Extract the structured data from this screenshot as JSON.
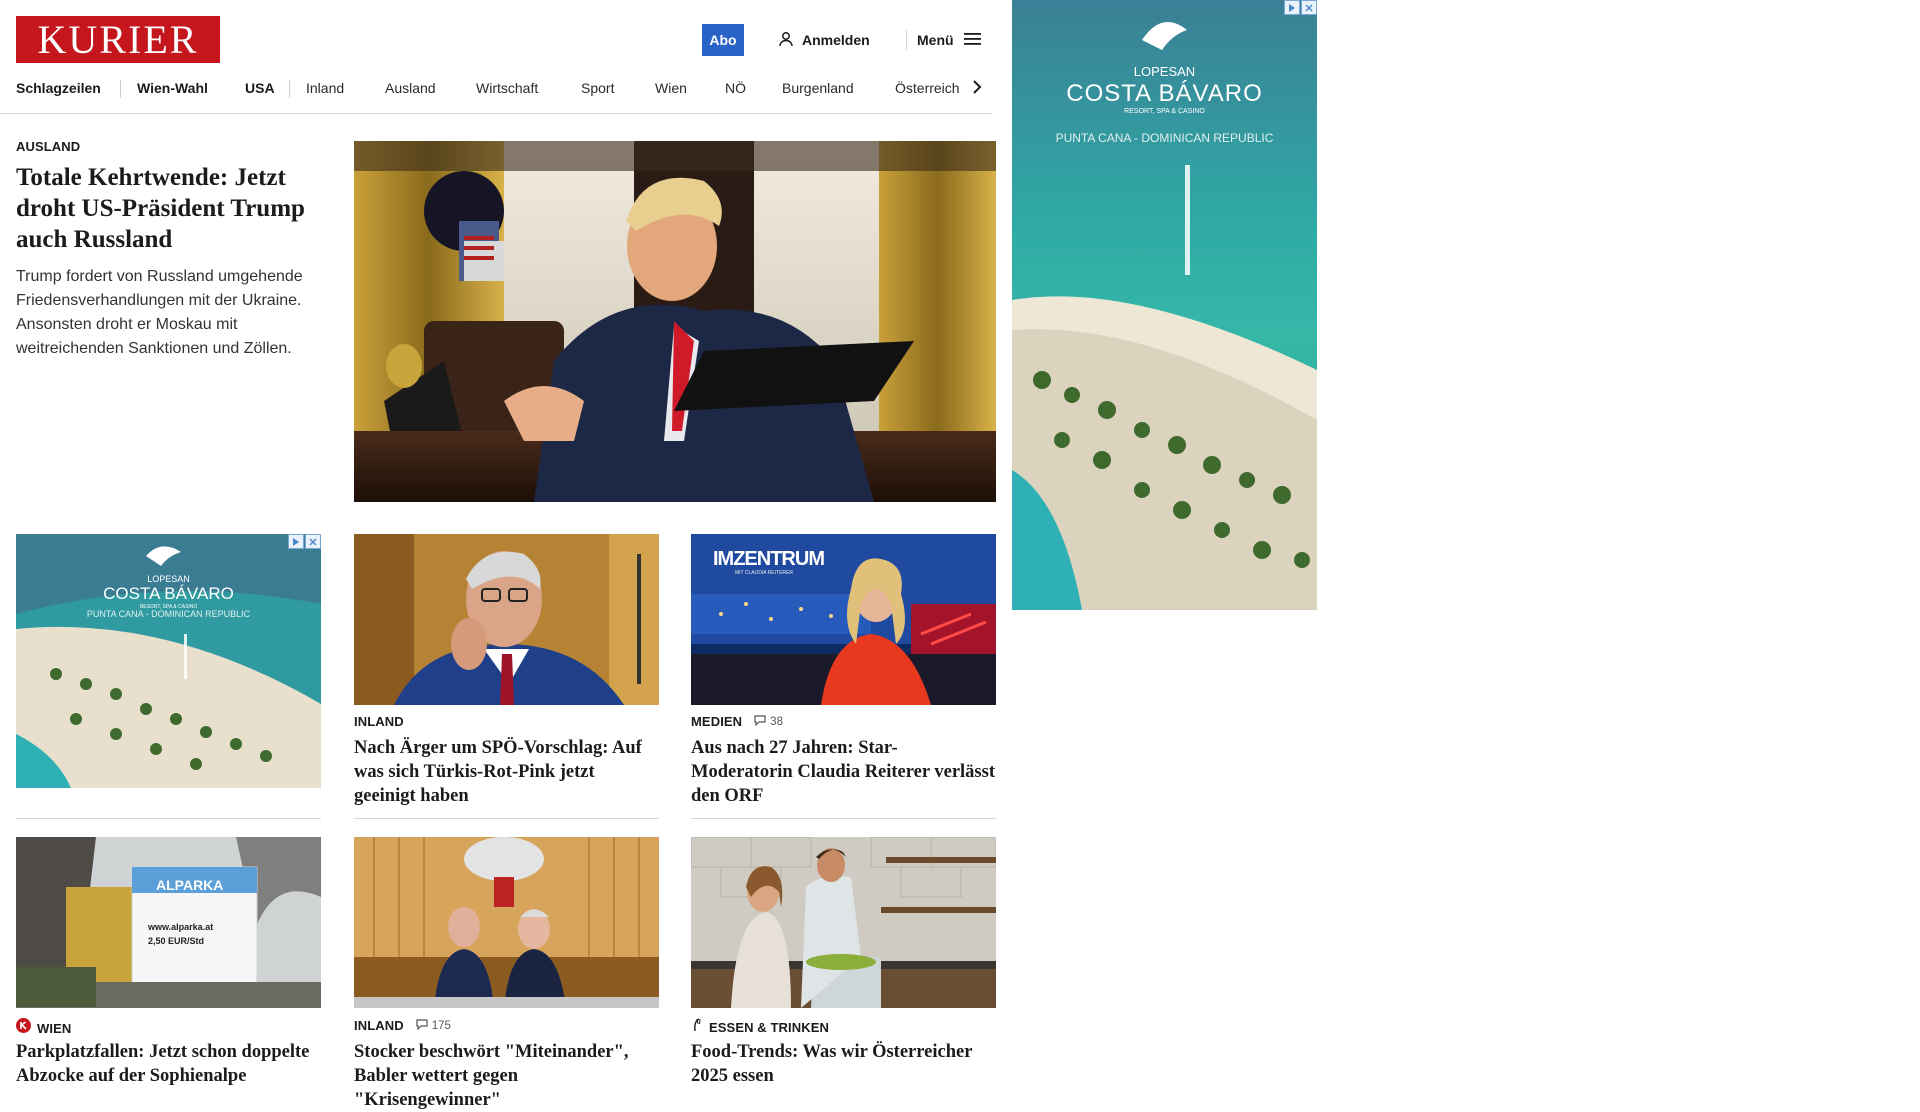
{
  "header": {
    "logo_text": "KURIER",
    "abo_label": "Abo",
    "login_label": "Anmelden",
    "menu_label": "Menü",
    "brand_color": "#c4161c",
    "abo_color": "#2a63c7"
  },
  "nav": {
    "items": [
      "Schlagzeilen",
      "Wien-Wahl",
      "USA",
      "Inland",
      "Ausland",
      "Wirtschaft",
      "Sport",
      "Wien",
      "NÖ",
      "Burgenland",
      "Österreich"
    ],
    "next_icon": "chevron-right-icon"
  },
  "lead": {
    "kicker": "AUSLAND",
    "title": "Totale Kehrtwende: Jetzt droht US-Präsident Trump auch Russland",
    "teaser": "Trump fordert von Russland umgehende Friedensverhandlungen mit der Ukraine. Ansonsten droht er Moskau mit weitreichenden Sanktionen und Zöllen."
  },
  "ads": {
    "brand_small": "LOPESAN",
    "brand_name": "COSTA BÁVARO",
    "brand_sub": "RESORT, SPA & CASINO",
    "location": "PUNTA CANA - DOMINICAN REPUBLIC"
  },
  "cards": [
    {
      "kicker": "INLAND",
      "comments": "",
      "title": "Nach Ärger um SPÖ-Vorschlag: Auf was sich Türkis-Rot-Pink jetzt geeinigt haben"
    },
    {
      "kicker": "MEDIEN",
      "comments": "38",
      "title": "Aus nach 27 Jahren: Star-Moderatorin Claudia Reiterer verlässt den ORF",
      "image_overlay": "IMZENTRUM",
      "image_overlay_sub": "MIT CLAUDIA REITERER"
    },
    {
      "kicker": "WIEN",
      "comments": "",
      "title": "Parkplatzfallen: Jetzt schon doppelte Abzocke auf der Sophienalpe",
      "image_sign_brand": "ALPARKA",
      "image_sign_url": "www.alparka.at",
      "image_sign_price": "2,50 EUR/Std"
    },
    {
      "kicker": "INLAND",
      "comments": "175",
      "title": "Stocker beschwört \"Miteinander\", Babler wettert gegen \"Krisengewinner\""
    },
    {
      "kicker": "ESSEN & TRINKEN",
      "comments": "",
      "title": "Food-Trends: Was wir Österreicher 2025 essen"
    }
  ]
}
